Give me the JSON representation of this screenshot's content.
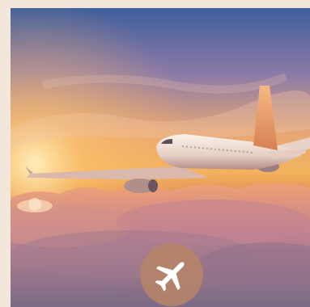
{
  "scene": {
    "image_label": "airplane-flying-above-clouds-at-sunset",
    "badge_icon": "airplane-icon",
    "colors": {
      "page_background": "#f3e6da",
      "badge": "#b58468",
      "sky_top": "#3f5f9c",
      "sunset_glow": "#f6b458"
    }
  }
}
